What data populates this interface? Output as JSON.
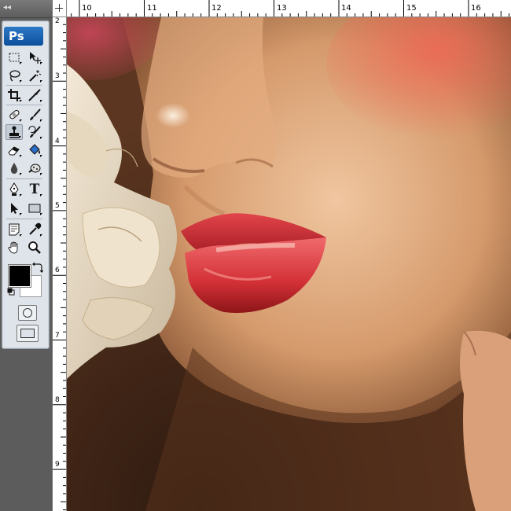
{
  "app": {
    "logo": "Ps",
    "collapse_icon": "double-left-chevron-icon"
  },
  "toolbar": {
    "tools": [
      {
        "name": "rectangular-marquee-tool",
        "icon": "marquee-icon"
      },
      {
        "name": "move-tool",
        "icon": "move-icon"
      },
      {
        "name": "lasso-tool",
        "icon": "lasso-icon"
      },
      {
        "name": "magic-wand-tool",
        "icon": "magic-wand-icon"
      },
      {
        "name": "crop-tool",
        "icon": "crop-icon"
      },
      {
        "name": "eyedropper-slice-tool",
        "icon": "slice-icon"
      },
      {
        "name": "healing-brush-tool",
        "icon": "bandage-icon"
      },
      {
        "name": "brush-tool",
        "icon": "brush-icon"
      },
      {
        "name": "clone-stamp-tool",
        "icon": "stamp-icon",
        "selected": true
      },
      {
        "name": "history-brush-tool",
        "icon": "history-brush-icon"
      },
      {
        "name": "eraser-tool",
        "icon": "eraser-icon"
      },
      {
        "name": "paint-bucket-tool",
        "icon": "bucket-icon"
      },
      {
        "name": "blur-tool",
        "icon": "drop-icon"
      },
      {
        "name": "dodge-tool",
        "icon": "sponge-icon"
      },
      {
        "name": "pen-tool",
        "icon": "pen-icon"
      },
      {
        "name": "type-tool",
        "icon": "type-icon",
        "glyph": "T"
      },
      {
        "name": "path-selection-tool",
        "icon": "arrow-icon"
      },
      {
        "name": "shape-tool",
        "icon": "rectangle-icon"
      },
      {
        "name": "notes-tool",
        "icon": "note-icon"
      },
      {
        "name": "eyedropper-tool",
        "icon": "eyedropper-icon"
      },
      {
        "name": "hand-tool",
        "icon": "hand-icon"
      },
      {
        "name": "zoom-tool",
        "icon": "magnifier-icon"
      }
    ],
    "foreground_color": "#000000",
    "background_color": "#ffffff"
  },
  "rulers": {
    "top_labels": [
      "10",
      "11",
      "12",
      "13",
      "14",
      "15",
      "16"
    ],
    "left_labels": [
      "2",
      "3",
      "4",
      "5",
      "6",
      "7",
      "8",
      "9"
    ]
  },
  "colors": {
    "workspace": "#6b6b6b",
    "panel": "#dfe4ea",
    "logo": "#1a5fae"
  }
}
